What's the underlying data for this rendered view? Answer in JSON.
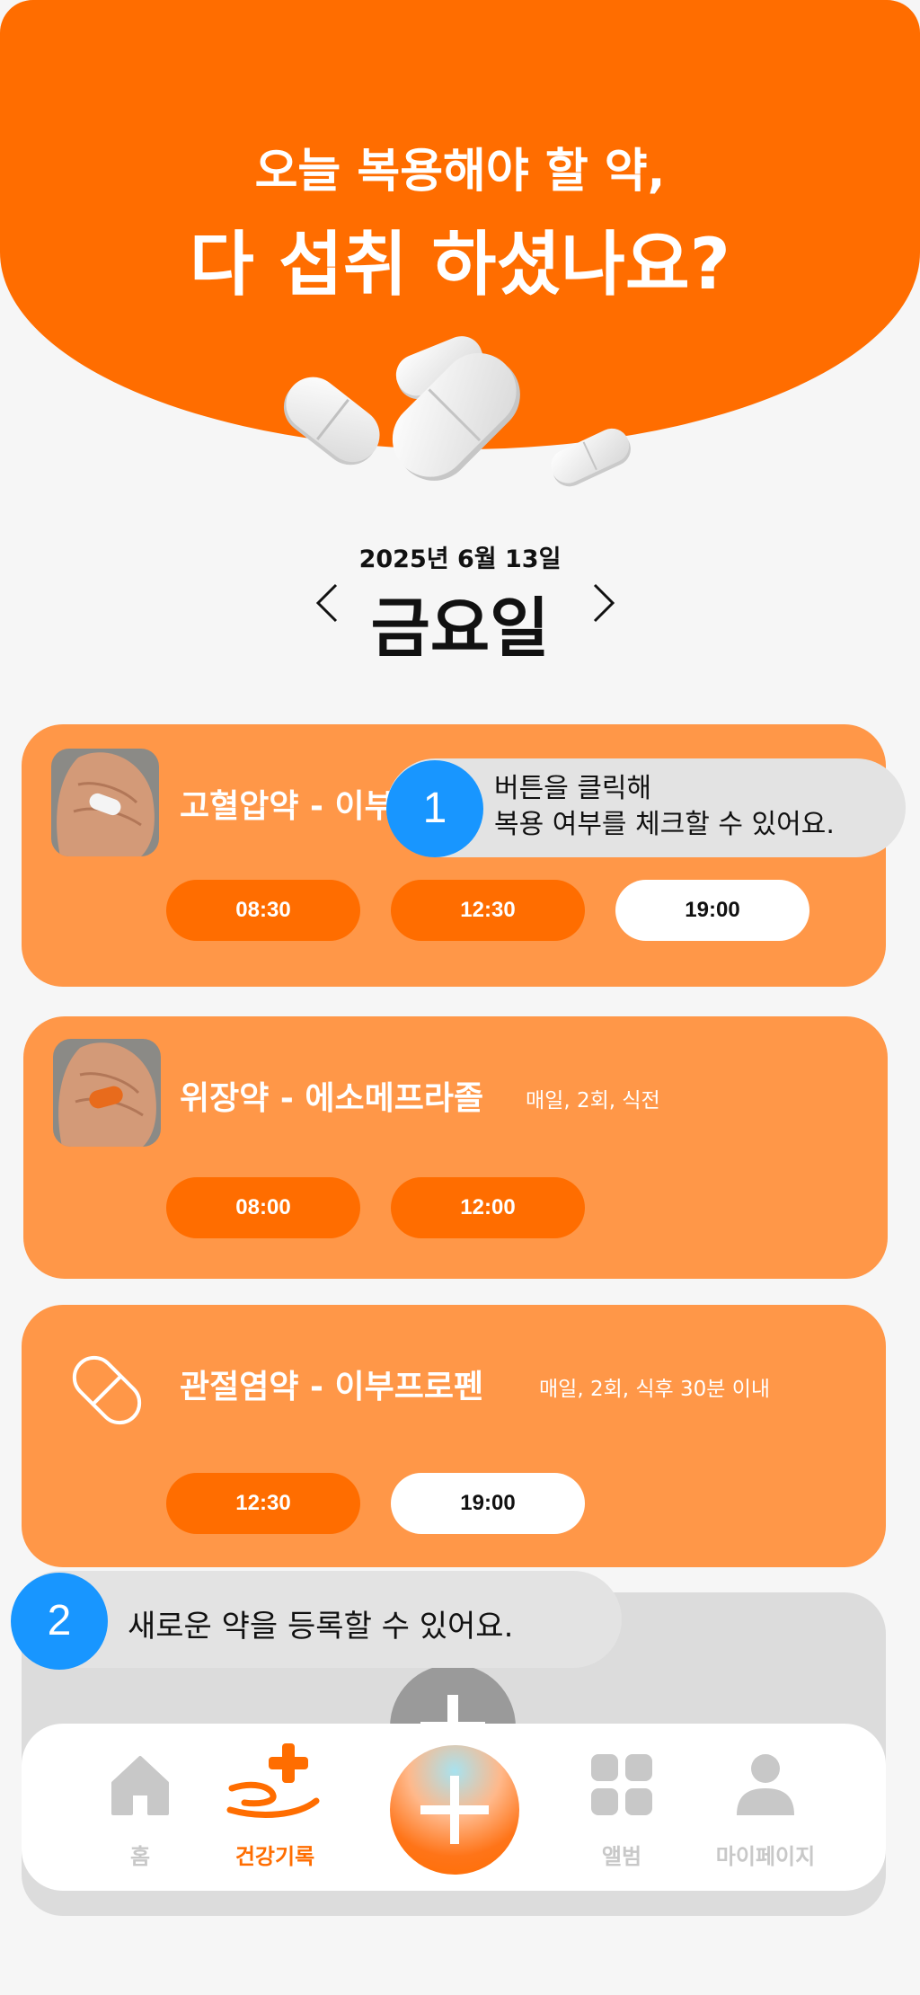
{
  "header": {
    "line1": "오늘 복용해야 할 약,",
    "line2": "다 섭취 하셨나요?"
  },
  "date": {
    "full": "2025년 6월 13일",
    "day": "금요일"
  },
  "meds": [
    {
      "name": "고혈압약 - 이부",
      "schedule": "",
      "times": [
        {
          "label": "08:30",
          "taken": false
        },
        {
          "label": "12:30",
          "taken": false
        },
        {
          "label": "19:00",
          "taken": true
        }
      ]
    },
    {
      "name": "위장약 - 에소메프라졸",
      "schedule": "매일, 2회, 식전",
      "times": [
        {
          "label": "08:00",
          "taken": false
        },
        {
          "label": "12:00",
          "taken": false
        }
      ]
    },
    {
      "name": "관절염약 - 이부프로펜",
      "schedule": "매일, 2회, 식후 30분 이내",
      "times": [
        {
          "label": "12:30",
          "taken": false
        },
        {
          "label": "19:00",
          "taken": true
        }
      ]
    }
  ],
  "tips": [
    {
      "num": "1",
      "line1": "버튼을 클릭해",
      "line2": "복용 여부를 체크할 수 있어요."
    },
    {
      "num": "2",
      "text": "새로운 약을 등록할 수 있어요."
    }
  ],
  "nav": {
    "home": "홈",
    "health": "건강기록",
    "album": "앨범",
    "mypage": "마이페이지"
  },
  "colors": {
    "accent": "#ff6d00",
    "card": "#ff9748",
    "tip_badge": "#1896ff",
    "inactive": "#c8c8c8"
  },
  "icons": [
    "pills-illustration",
    "chevron-left-icon",
    "chevron-right-icon",
    "pill-outline-icon",
    "plus-icon",
    "home-icon",
    "health-record-icon",
    "album-grid-icon",
    "person-icon"
  ]
}
